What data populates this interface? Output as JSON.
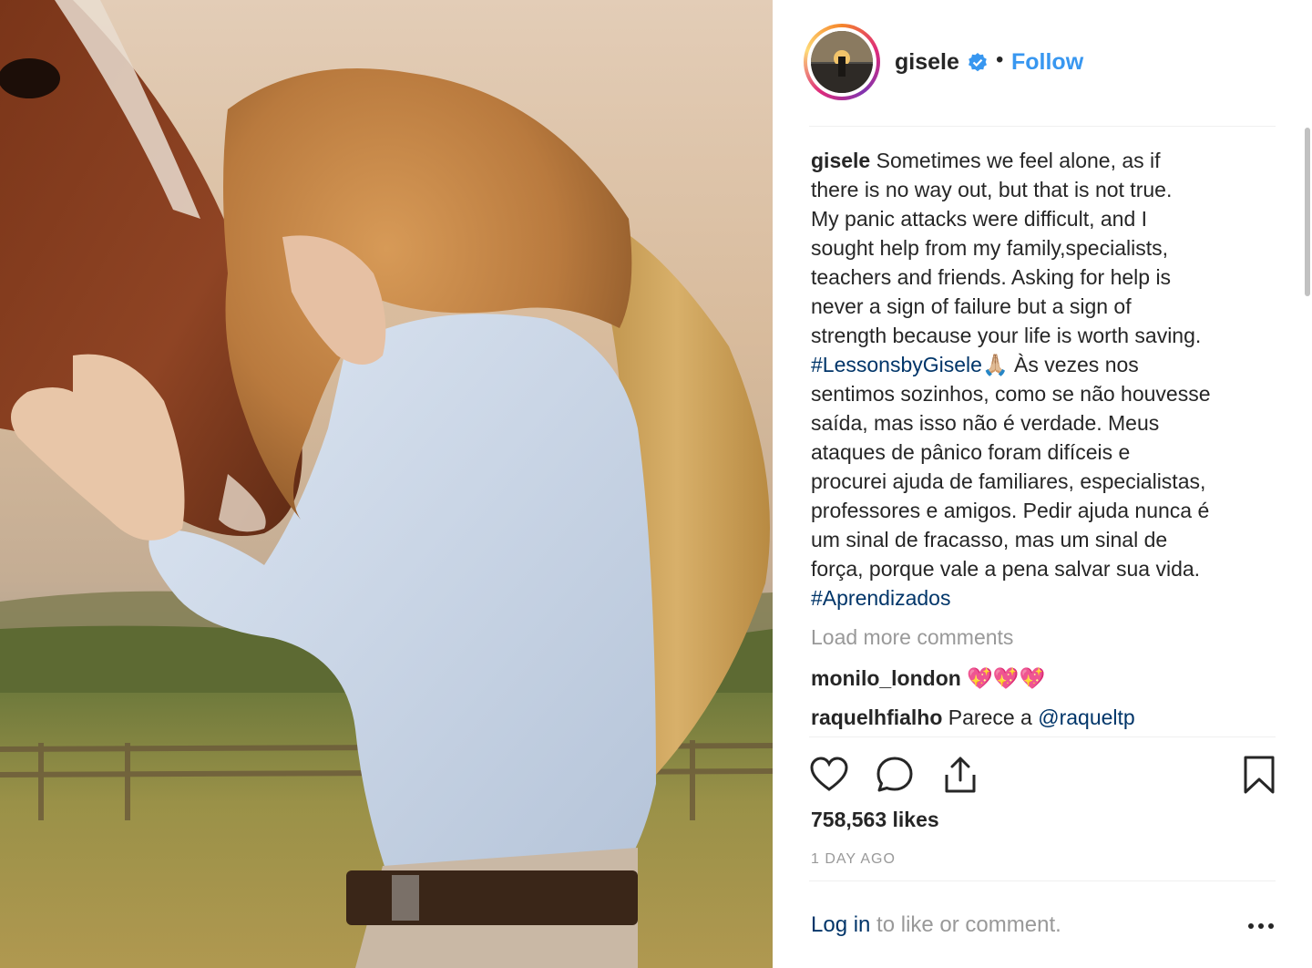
{
  "post": {
    "username": "gisele",
    "header_separator": "•",
    "follow_label": "Follow",
    "caption_lines": [
      "Sometimes we feel alone, as if",
      "there is no way out, but that is not true.",
      "My panic attacks were difficult, and I",
      "sought help from my family,specialists,",
      "teachers and friends. Asking for help is",
      "never a sign of failure but a sign of",
      "strength because your life is worth saving.",
      "Às vezes nos",
      "sentimos sozinhos, como se não houvesse",
      "saída, mas isso não é verdade. Meus",
      "ataques de pânico foram difíceis e",
      "procurei ajuda de familiares, especialistas,",
      "professores e amigos. Pedir ajuda nunca é",
      "um sinal de fracasso, mas um sinal de",
      "força, porque vale a pena salvar sua vida."
    ],
    "hashtag_1": "#LessonsbyGisele",
    "prayer_emoji": "🙏🏼",
    "hashtag_2": "#Aprendizados",
    "load_more_label": "Load more comments",
    "comments": [
      {
        "username": "monilo_london",
        "emoji": "💖💖💖"
      },
      {
        "username": "raquelhfialho",
        "text": "Parece a",
        "mention": "@raquelt​p"
      }
    ],
    "likes_label": "758,563 likes",
    "time_label": "1 DAY AGO",
    "login_label": "Log in",
    "login_suffix": " to like or comment."
  },
  "icons": {
    "verified": "verified-badge-icon",
    "like": "heart-icon",
    "comment": "comment-bubble-icon",
    "share": "share-icon",
    "save": "bookmark-icon",
    "more": "more-dots-icon"
  },
  "colors": {
    "follow": "#3897f0",
    "hashtag": "#003569",
    "muted": "#999999",
    "text": "#262626"
  }
}
